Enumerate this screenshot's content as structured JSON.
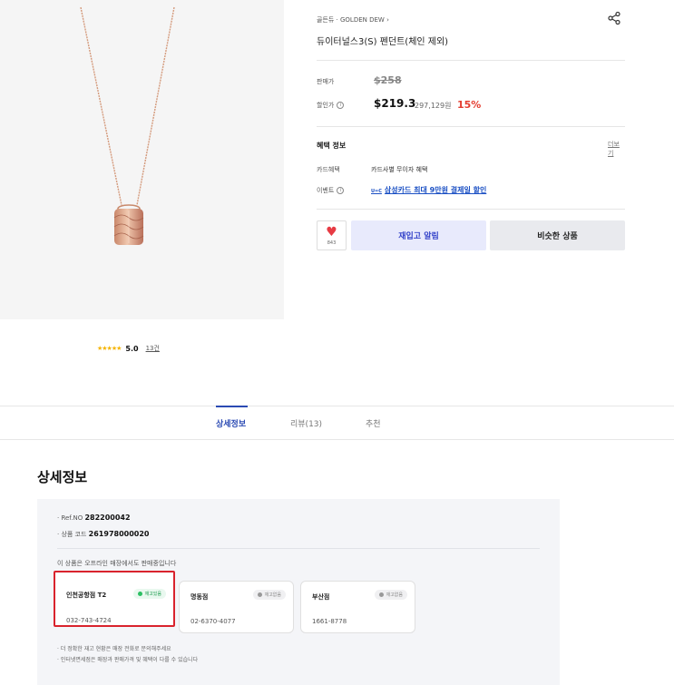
{
  "product": {
    "breadcrumb": "골든듀 · GOLDEN DEW",
    "title": "듀이터널스3(S) 펜던트(체인 제외)"
  },
  "price": {
    "list_label": "판매가",
    "list_value": "$258",
    "sale_label": "할인가",
    "sale_value": "$219.3",
    "krw_value": "297,129원",
    "discount": "15%"
  },
  "benefits": {
    "title": "혜택 정보",
    "more_label": "더보기",
    "card_label": "카드혜택",
    "card_value": "카드사별 무이자 혜택",
    "event_label": "이벤트",
    "event_tag": "U=C",
    "event_value": "삼성카드 최대 9만원 결제일 할인"
  },
  "actions": {
    "like_count": "843",
    "restock_label": "재입고 알림",
    "similar_label": "비슷한 상품"
  },
  "rating": {
    "stars": "★★★★★",
    "score": "5.0",
    "count": "13건"
  },
  "tabs": [
    {
      "label": "상세정보"
    },
    {
      "label": "리뷰(13)"
    },
    {
      "label": "추천"
    }
  ],
  "detail": {
    "section_title": "상세정보",
    "ref_label": "· Ref.NO",
    "ref_value": "282200042",
    "code_label": "· 상품 코드",
    "code_value": "261978000020",
    "offline_note": "이 상품은 오프라인 매장에서도 판매중입니다",
    "stores": [
      {
        "name": "인천공항점 T2",
        "status": "재고있음",
        "phone": "032-743-4724"
      },
      {
        "name": "명동점",
        "status": "재고없음",
        "phone": "02-6370-4077"
      },
      {
        "name": "부산점",
        "status": "재고없음",
        "phone": "1661-8778"
      }
    ],
    "notes": [
      "· 더 정확한 재고 현황은 매장 전화로 문의해주세요",
      "· 인터넷면세점은 매장과 판매가격 및 혜택이 다를 수 있습니다"
    ]
  },
  "colors": {
    "accent": "#2b4ab3",
    "discount": "#e43d30",
    "highlight_border": "#d9232d",
    "in_stock": "#2cbf63"
  }
}
